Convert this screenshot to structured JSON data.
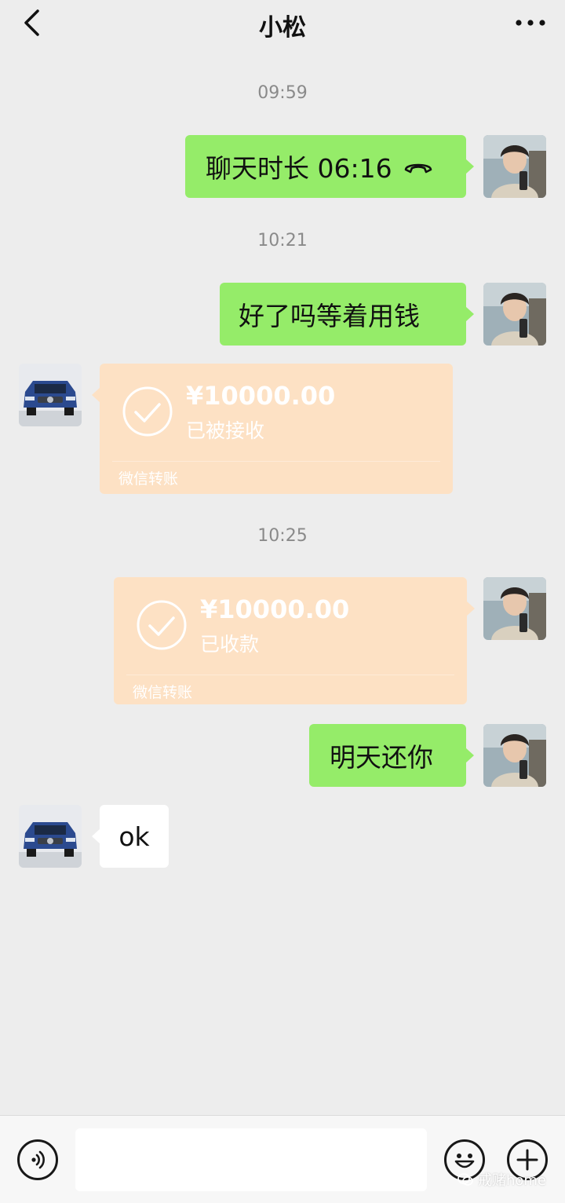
{
  "header": {
    "title": "小松",
    "back_icon": "chevron-left-icon",
    "more_icon": "more-dots-icon"
  },
  "colors": {
    "background": "#ededed",
    "sent_bubble": "#95ec69",
    "received_bubble": "#ffffff",
    "transfer_card": "#fde1c4",
    "timestamp": "#8a8a8a"
  },
  "messages": {
    "t1": "09:59",
    "m1": {
      "text": "聊天时长 06:16",
      "icon": "hangup-phone-icon"
    },
    "t2": "10:21",
    "m2": {
      "text": "好了吗等着用钱"
    },
    "m3": {
      "amount": "¥10000.00",
      "status": "已被接收",
      "label": "微信转账"
    },
    "t3": "10:25",
    "m4": {
      "amount": "¥10000.00",
      "status": "已收款",
      "label": "微信转账"
    },
    "m5": {
      "text": "明天还你"
    },
    "m6": {
      "text": "ok"
    }
  },
  "footer": {
    "voice_icon": "voice-icon",
    "emoji_icon": "emoji-icon",
    "plus_icon": "plus-icon",
    "watermark": "戒赌home"
  }
}
